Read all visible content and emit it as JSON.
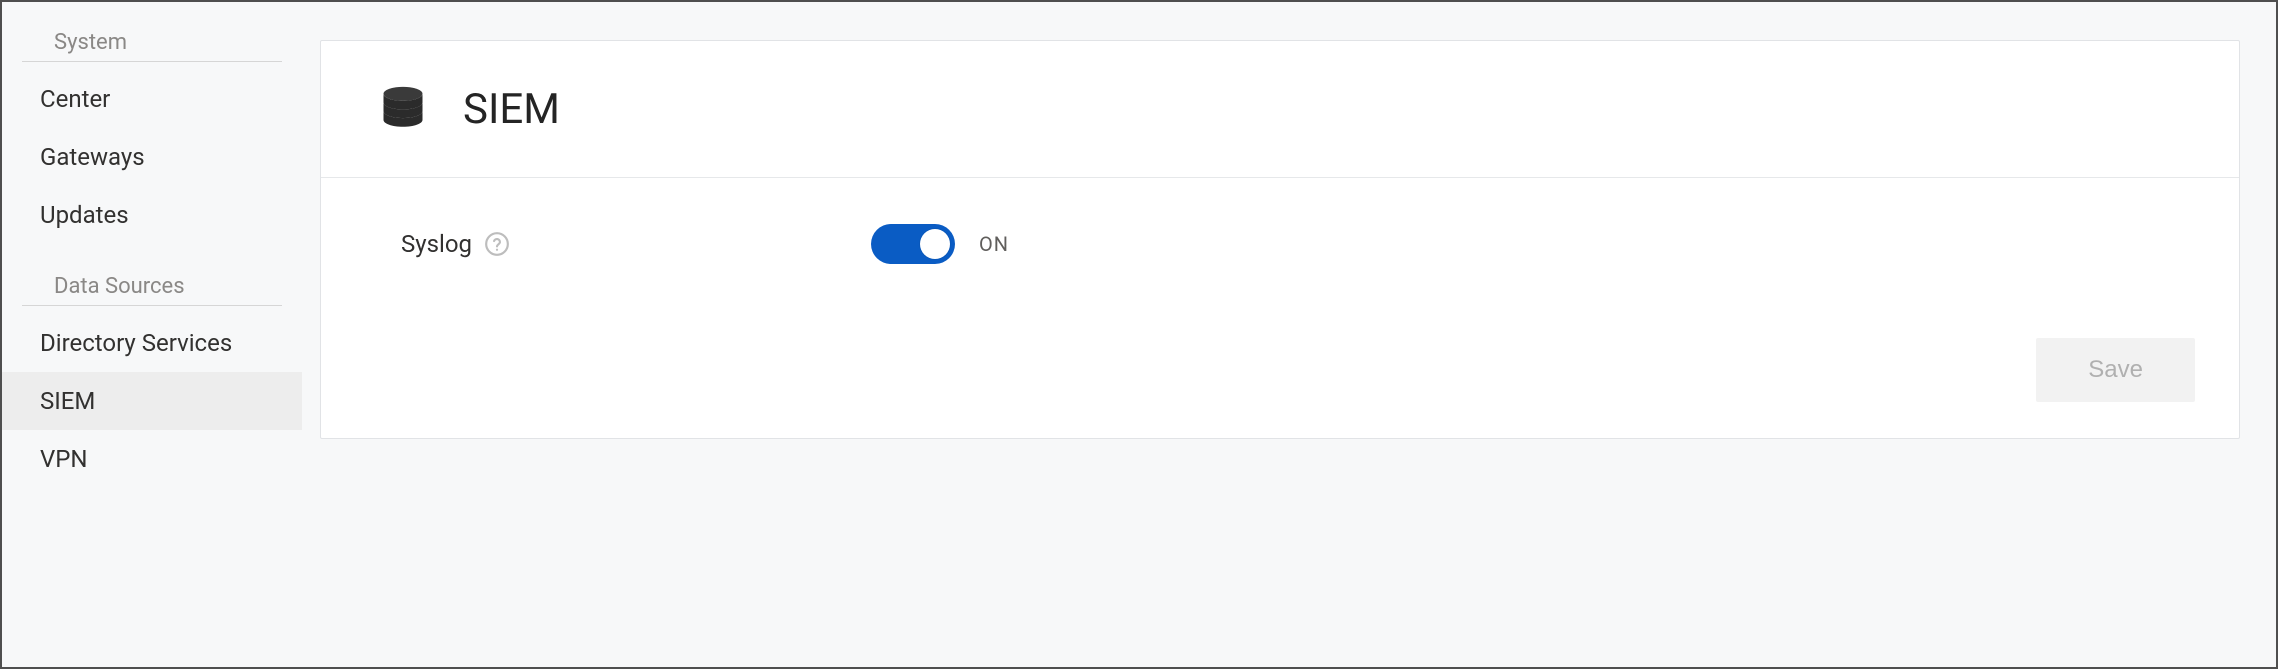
{
  "sidebar": {
    "groups": [
      {
        "title": "System",
        "items": [
          {
            "label": "Center",
            "selected": false
          },
          {
            "label": "Gateways",
            "selected": false
          },
          {
            "label": "Updates",
            "selected": false
          }
        ]
      },
      {
        "title": "Data Sources",
        "items": [
          {
            "label": "Directory Services",
            "selected": false
          },
          {
            "label": "SIEM",
            "selected": true
          },
          {
            "label": "VPN",
            "selected": false
          }
        ]
      }
    ]
  },
  "main": {
    "title": "SIEM",
    "icon": "database-icon",
    "settings": {
      "syslog": {
        "label": "Syslog",
        "state_label": "ON",
        "on": true
      }
    },
    "save_label": "Save",
    "save_enabled": false
  },
  "colors": {
    "accent": "#0a5cc4",
    "panel_border": "#e1e3e6",
    "bg": "#f7f8f9"
  }
}
